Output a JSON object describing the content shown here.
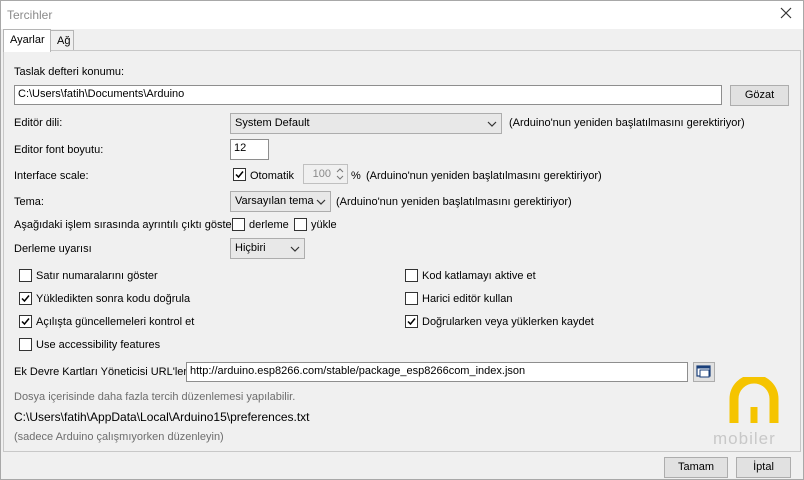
{
  "window": {
    "title": "Tercihler"
  },
  "tabs": [
    {
      "label": "Ayarlar"
    },
    {
      "label": "Ağ"
    }
  ],
  "sketchbook": {
    "label": "Taslak defteri konumu:",
    "value": "C:\\Users\\fatih\\Documents\\Arduino",
    "browse_label": "Gözat"
  },
  "editor_language": {
    "label": "Editör dili:",
    "selected": "System Default",
    "note": "(Arduino'nun yeniden başlatılmasını gerektiriyor)"
  },
  "font_size": {
    "label": "Editor font boyutu:",
    "value": "12"
  },
  "interface_scale": {
    "label": "Interface scale:",
    "auto_label": "Otomatik",
    "auto_checked": true,
    "value": "100",
    "unit": "%",
    "note": "(Arduino'nun yeniden başlatılmasını gerektiriyor)"
  },
  "theme": {
    "label": "Tema:",
    "selected": "Varsayılan tema",
    "note": "(Arduino'nun yeniden başlatılmasını gerektiriyor)"
  },
  "verbose": {
    "label": "Aşağıdaki işlem sırasında ayrıntılı çıktı göster:",
    "compile_label": "derleme",
    "compile_checked": false,
    "upload_label": "yükle",
    "upload_checked": false
  },
  "warnings": {
    "label": "Derleme uyarısı",
    "selected": "Hiçbiri"
  },
  "options_left": [
    {
      "label": "Satır numaralarını göster",
      "checked": false
    },
    {
      "label": "Yükledikten sonra kodu doğrula",
      "checked": true
    },
    {
      "label": "Açılışta güncellemeleri kontrol et",
      "checked": true
    },
    {
      "label": "Use accessibility features",
      "checked": false
    }
  ],
  "options_right": [
    {
      "label": "Kod katlamayı aktive et",
      "checked": false
    },
    {
      "label": "Harici editör kullan",
      "checked": false
    },
    {
      "label": "Doğrularken veya yüklerken kaydet",
      "checked": true
    }
  ],
  "board_urls": {
    "label": "Ek Devre Kartları Yöneticisi URL'leri:",
    "value": "http://arduino.esp8266.com/stable/package_esp8266com_index.json"
  },
  "footer": {
    "more_prefs": "Dosya içerisinde daha fazla tercih düzenlemesi yapılabilir.",
    "prefs_path": "C:\\Users\\fatih\\AppData\\Local\\Arduino15\\preferences.txt",
    "edit_note": "(sadece Arduino çalışmıyorken düzenleyin)"
  },
  "watermark": {
    "text": "mobiler",
    "color": "#f5c400"
  },
  "buttons": {
    "ok": "Tamam",
    "cancel": "İptal"
  }
}
